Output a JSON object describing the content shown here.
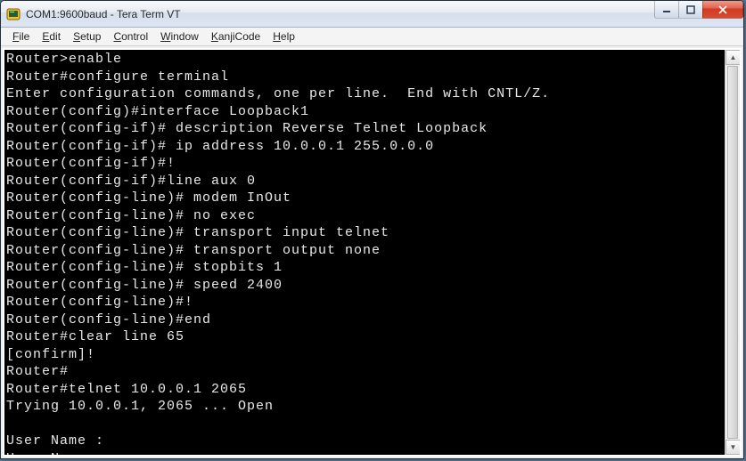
{
  "window": {
    "title": "COM1:9600baud - Tera Term VT"
  },
  "menu": {
    "file": {
      "mnemonic": "F",
      "rest": "ile"
    },
    "edit": {
      "mnemonic": "E",
      "rest": "dit"
    },
    "setup": {
      "mnemonic": "S",
      "rest": "etup"
    },
    "control": {
      "mnemonic": "C",
      "rest": "ontrol"
    },
    "window_": {
      "mnemonic": "W",
      "rest": "indow"
    },
    "kanjicode": {
      "mnemonic": "K",
      "rest": "anjiCode"
    },
    "help": {
      "mnemonic": "H",
      "rest": "elp"
    }
  },
  "terminal": {
    "lines": [
      "Router>enable",
      "Router#configure terminal",
      "Enter configuration commands, one per line.  End with CNTL/Z.",
      "Router(config)#interface Loopback1",
      "Router(config-if)# description Reverse Telnet Loopback",
      "Router(config-if)# ip address 10.0.0.1 255.0.0.0",
      "Router(config-if)#!",
      "Router(config-if)#line aux 0",
      "Router(config-line)# modem InOut",
      "Router(config-line)# no exec",
      "Router(config-line)# transport input telnet",
      "Router(config-line)# transport output none",
      "Router(config-line)# stopbits 1",
      "Router(config-line)# speed 2400",
      "Router(config-line)#!",
      "Router(config-line)#end",
      "Router#clear line 65",
      "[confirm]!",
      "Router#",
      "Router#telnet 10.0.0.1 2065",
      "Trying 10.0.0.1, 2065 ... Open",
      "",
      "User Name : ",
      "User Name : "
    ]
  }
}
